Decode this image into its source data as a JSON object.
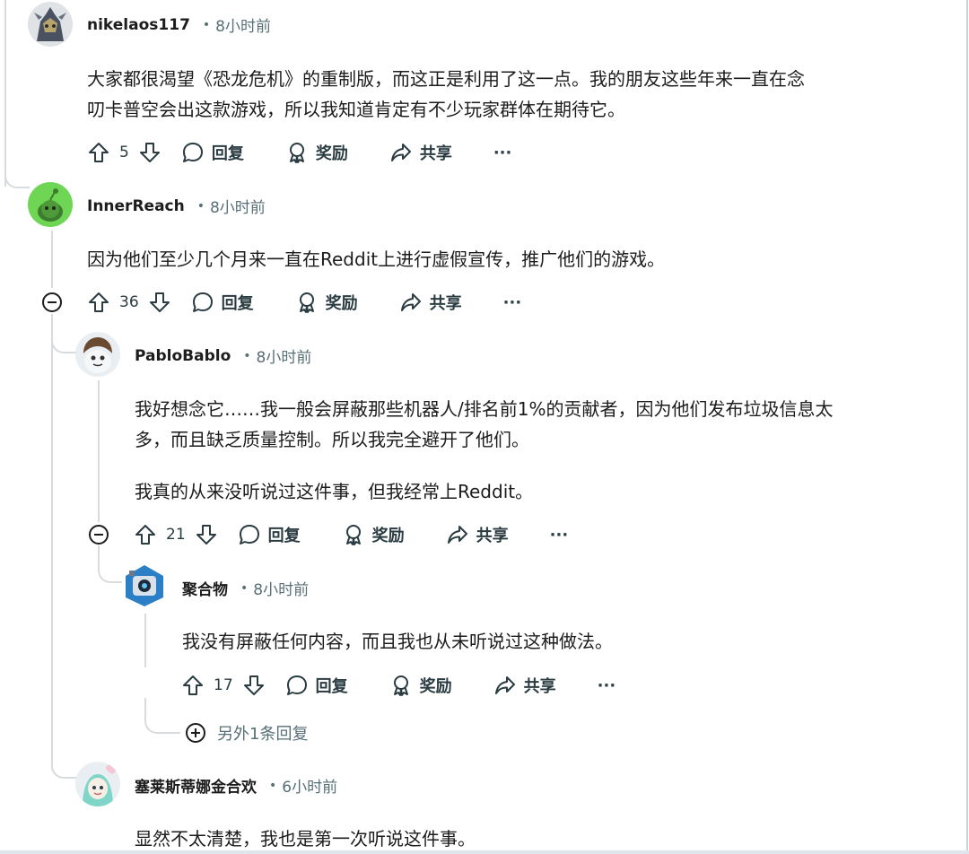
{
  "comments": [
    {
      "username": "nikelaos117",
      "time": "8小时前",
      "lines": [
        "大家都很渴望《恐龙危机》的重制版，而这正是利用了这一点。我的朋友这些年来一直在念",
        "叨卡普空会出这款游戏，所以我知道肯定有不少玩家群体在期待它。"
      ],
      "votes": "5",
      "reply_label": "回复",
      "award_label": "奖励",
      "share_label": "共享",
      "more_label": "···"
    },
    {
      "username": "InnerReach",
      "time": "8小时前",
      "lines": [
        "因为他们至少几个月来一直在Reddit上进行虚假宣传，推广他们的游戏。"
      ],
      "votes": "36",
      "reply_label": "回复",
      "award_label": "奖励",
      "share_label": "共享",
      "more_label": "···"
    },
    {
      "username": "PabloBablo",
      "time": "8小时前",
      "lines": [
        "我好想念它……我一般会屏蔽那些机器人/排名前1%的贡献者，因为他们发布垃圾信息太",
        "多，而且缺乏质量控制。所以我完全避开了他们。"
      ],
      "lines2": [
        "我真的从来没听说过这件事，但我经常上Reddit。"
      ],
      "votes": "21",
      "reply_label": "回复",
      "award_label": "奖励",
      "share_label": "共享",
      "more_label": "···"
    },
    {
      "username": "聚合物",
      "time": "8小时前",
      "lines": [
        "我没有屏蔽任何内容，而且我也从未听说过这种做法。"
      ],
      "votes": "17",
      "reply_label": "回复",
      "award_label": "奖励",
      "share_label": "共享",
      "more_label": "···",
      "more_replies": "另外1条回复"
    },
    {
      "username": "塞莱斯蒂娜金合欢",
      "time": "6小时前",
      "lines": [
        "显然不太清楚，我也是第一次听说这件事。"
      ]
    }
  ],
  "colors": {
    "text": "#1c1c1c",
    "meta": "#576f76",
    "thread_line": "#d7dbdd",
    "reddit_green": "#6fd655"
  },
  "icons": [
    "upvote-icon",
    "downvote-icon",
    "comment-icon",
    "award-icon",
    "share-icon",
    "collapse-icon",
    "expand-icon"
  ]
}
